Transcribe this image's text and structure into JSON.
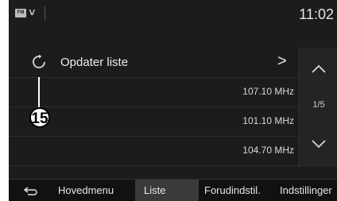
{
  "status_bar": {
    "source_badge": "FM",
    "source_chevron": "∨",
    "clock": "11:02"
  },
  "list": {
    "refresh_label": "Opdater liste",
    "refresh_chevron": ">",
    "frequencies": [
      "107.10 MHz",
      "101.10 MHz",
      "104.70 MHz"
    ]
  },
  "scroll": {
    "page_indicator": "1/5"
  },
  "annotation": {
    "callout_number": "15"
  },
  "tabs": {
    "hovedmenu": "Hovedmenu",
    "liste": "Liste",
    "forudindstil": "Forudindstil.",
    "indstillinger": "Indstillinger"
  },
  "icons": {
    "refresh": "refresh-icon",
    "back": "back-arrow-icon",
    "up": "chevron-up-icon",
    "down": "chevron-down-icon"
  },
  "colors": {
    "screen_bg": "#1c1c1e",
    "active_tab_bg": "#3a3a3c"
  }
}
